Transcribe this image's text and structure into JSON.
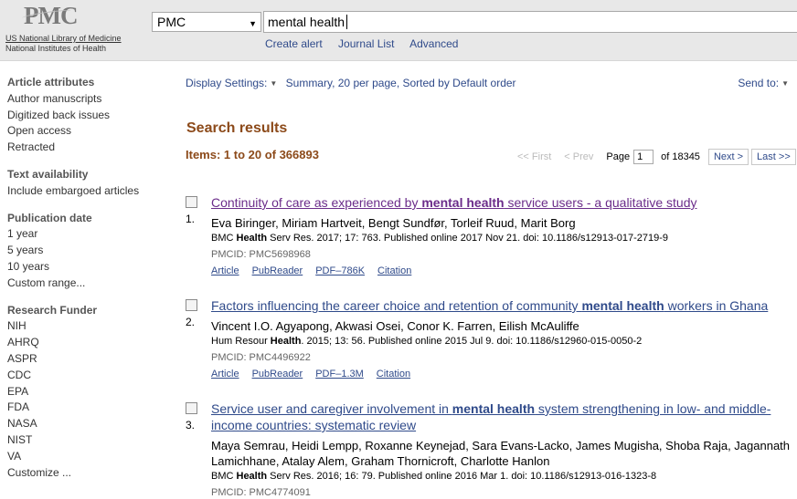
{
  "header": {
    "logo_text": "PMC",
    "logo_line1": "US National Library of Medicine",
    "logo_line2": "National Institutes of Health",
    "database": "PMC",
    "search_value": "mental health",
    "links": [
      "Create alert",
      "Journal List",
      "Advanced"
    ]
  },
  "sidebar": {
    "groups": [
      {
        "title": "Article attributes",
        "items": [
          "Author manuscripts",
          "Digitized back issues",
          "Open access",
          "Retracted"
        ]
      },
      {
        "title": "Text availability",
        "items": [
          "Include embargoed articles"
        ]
      },
      {
        "title": "Publication date",
        "items": [
          "1 year",
          "5 years",
          "10 years",
          "Custom range..."
        ]
      },
      {
        "title": "Research Funder",
        "items": [
          "NIH",
          "AHRQ",
          "ASPR",
          "CDC",
          "EPA",
          "FDA",
          "NASA",
          "NIST",
          "VA",
          "Customize ..."
        ]
      }
    ]
  },
  "display": {
    "settings_label": "Display Settings:",
    "summary": "Summary, 20 per page, Sorted by Default order",
    "send_to": "Send to:"
  },
  "results_title": "Search results",
  "items_count": "Items: 1 to 20 of 366893",
  "pager": {
    "first": "<< First",
    "prev": "< Prev",
    "page_label": "Page",
    "page_value": "1",
    "of_pages": "of 18345",
    "next": "Next >",
    "last": "Last >>"
  },
  "results": [
    {
      "number": "1.",
      "title_before": "Continuity of care as experienced by ",
      "title_bold": "mental health",
      "title_after": " service users - a qualitative study",
      "title_color": "#6b2c8a",
      "authors": "Eva Biringer, Miriam Hartveit, Bengt Sundfør, Torleif Ruud, Marit Borg",
      "journal_before": "BMC ",
      "journal_bold": "Health",
      "journal_after": " Serv Res. 2017; 17: 763. Published online 2017 Nov 21. doi: 10.1186/s12913-017-2719-9",
      "pmcid": "PMCID: PMC5698968",
      "links": [
        "Article",
        "PubReader",
        "PDF–786K",
        "Citation"
      ]
    },
    {
      "number": "2.",
      "title_before": "Factors influencing the career choice and retention of community ",
      "title_bold": "mental health",
      "title_after": " workers in Ghana",
      "title_color": "#2f4a8a",
      "authors": "Vincent I.O. Agyapong, Akwasi Osei, Conor K. Farren, Eilish McAuliffe",
      "journal_before": "Hum Resour ",
      "journal_bold": "Health",
      "journal_after": ". 2015; 13: 56. Published online 2015 Jul 9. doi: 10.1186/s12960-015-0050-2",
      "pmcid": "PMCID: PMC4496922",
      "links": [
        "Article",
        "PubReader",
        "PDF–1.3M",
        "Citation"
      ]
    },
    {
      "number": "3.",
      "title_before": "Service user and caregiver involvement in ",
      "title_bold": "mental health",
      "title_after": " system strengthening in low- and middle-income countries: systematic review",
      "title_color": "#2f4a8a",
      "authors": "Maya Semrau, Heidi Lempp, Roxanne Keynejad, Sara Evans-Lacko, James Mugisha, Shoba Raja, Jagannath Lamichhane, Atalay Alem, Graham Thornicroft, Charlotte Hanlon",
      "journal_before": "BMC ",
      "journal_bold": "Health",
      "journal_after": " Serv Res. 2016; 16: 79. Published online 2016 Mar 1. doi: 10.1186/s12913-016-1323-8",
      "pmcid": "PMCID: PMC4774091",
      "links": []
    }
  ]
}
